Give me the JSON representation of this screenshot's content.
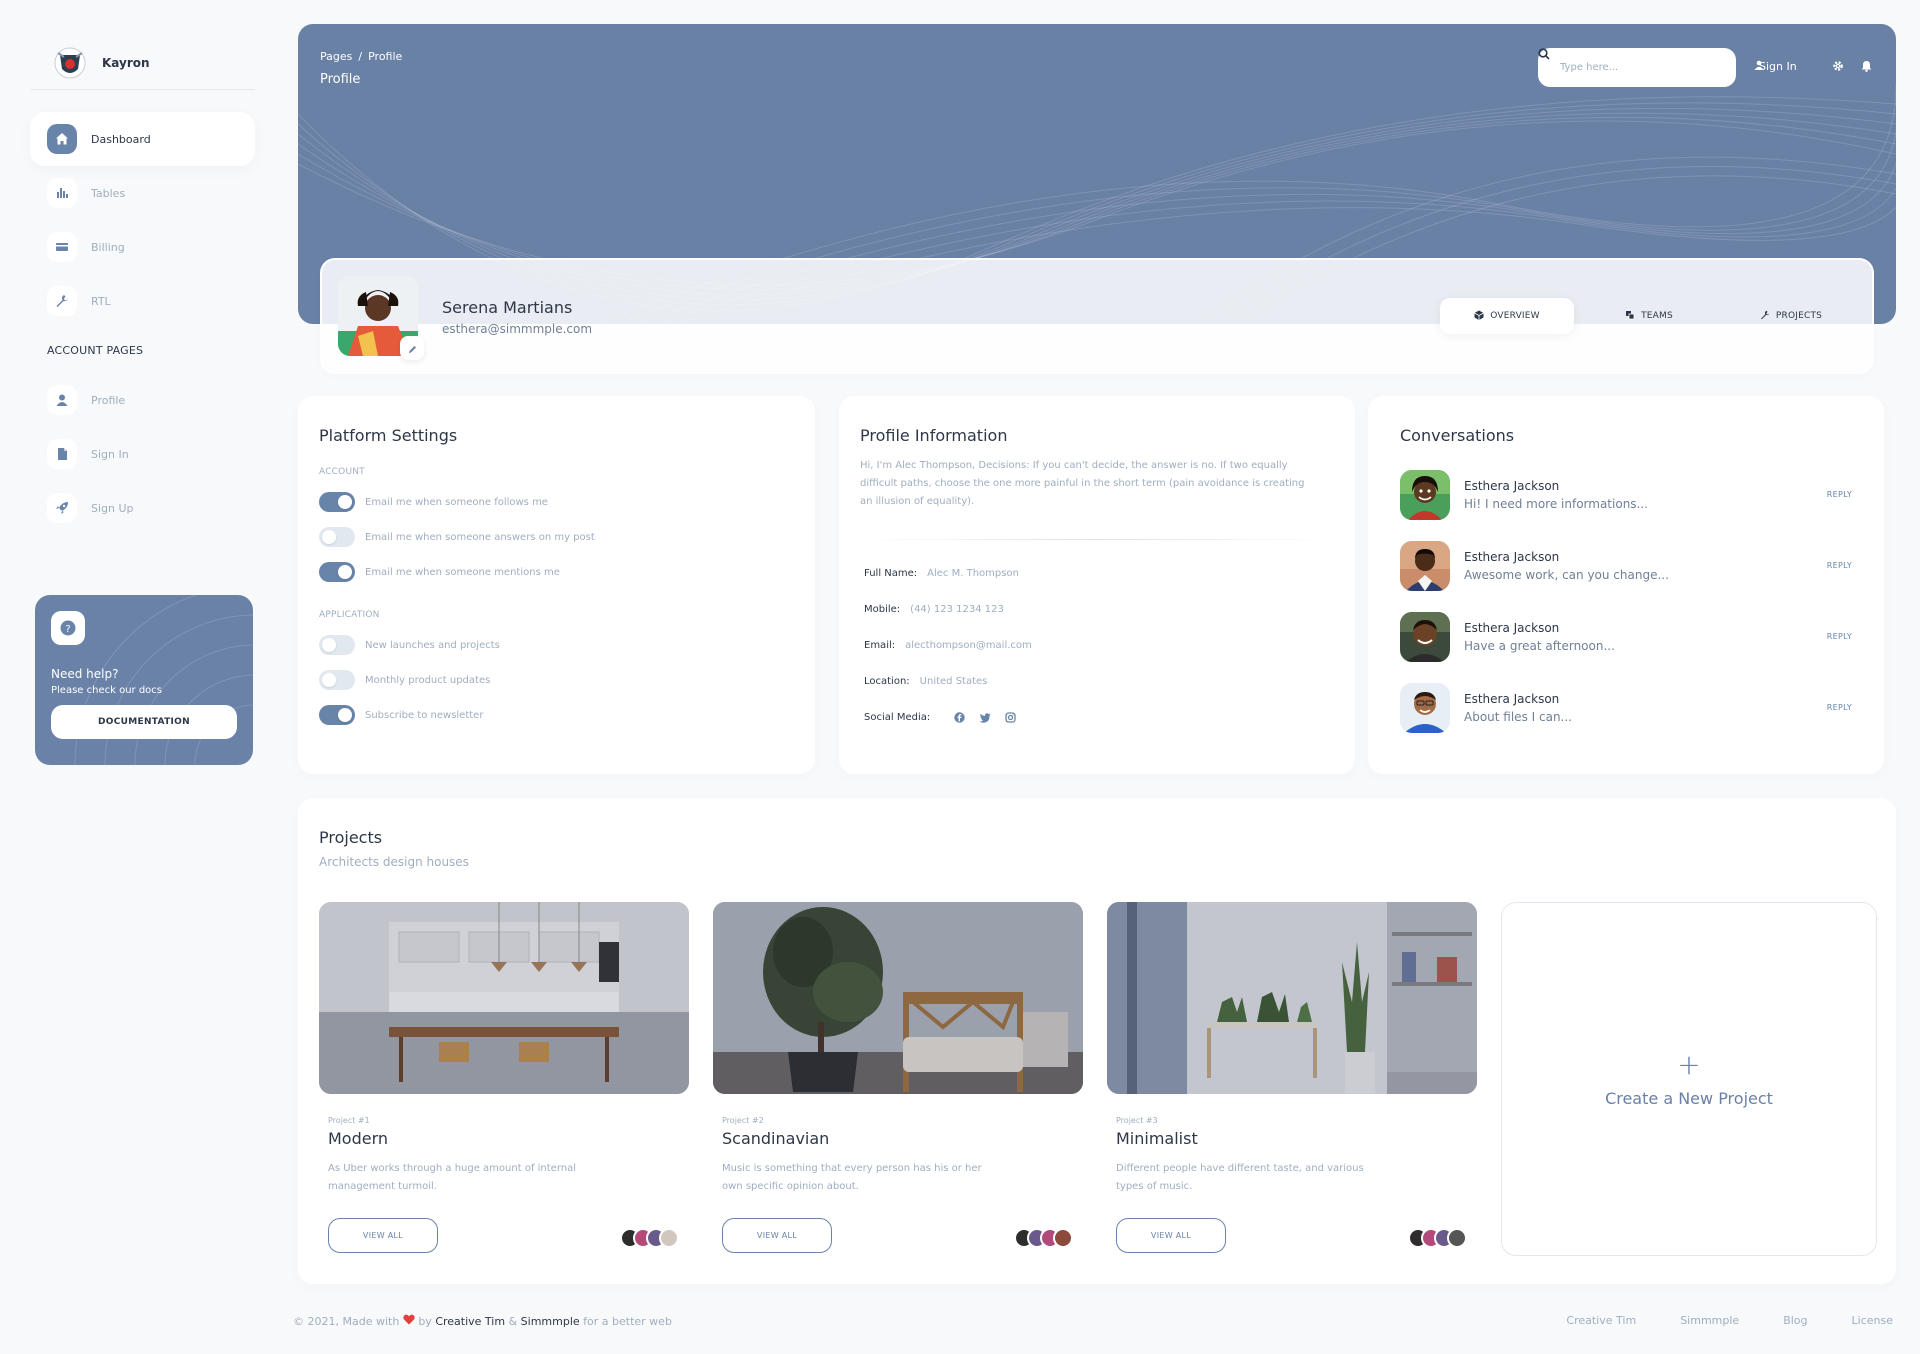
{
  "brand": {
    "name": "Kayron"
  },
  "sidebar": {
    "items": [
      {
        "label": "Dashboard",
        "icon": "home-icon",
        "active": true
      },
      {
        "label": "Tables",
        "icon": "bar-chart-icon"
      },
      {
        "label": "Billing",
        "icon": "credit-card-icon"
      },
      {
        "label": "RTL",
        "icon": "wrench-icon"
      }
    ],
    "account_title": "ACCOUNT PAGES",
    "account_items": [
      {
        "label": "Profile",
        "icon": "person-icon"
      },
      {
        "label": "Sign In",
        "icon": "document-icon"
      },
      {
        "label": "Sign Up",
        "icon": "rocket-icon"
      }
    ]
  },
  "help": {
    "title": "Need help?",
    "subtitle": "Please check our docs",
    "button": "DOCUMENTATION"
  },
  "header": {
    "breadcrumb_root": "Pages",
    "breadcrumb_sep": "/",
    "breadcrumb_current": "Profile",
    "title": "Profile",
    "search_placeholder": "Type here...",
    "sign_in": "Sign In"
  },
  "profile": {
    "name": "Serena Martians",
    "email": "esthera@simmmple.com",
    "tabs": [
      "OVERVIEW",
      "TEAMS",
      "PROJECTS"
    ]
  },
  "settings": {
    "title": "Platform Settings",
    "account_label": "ACCOUNT",
    "account": [
      {
        "label": "Email me when someone follows me",
        "on": true
      },
      {
        "label": "Email me when someone answers on my post",
        "on": false
      },
      {
        "label": "Email me when someone mentions me",
        "on": true
      }
    ],
    "application_label": "APPLICATION",
    "application": [
      {
        "label": "New launches and projects",
        "on": false
      },
      {
        "label": "Monthly product updates",
        "on": false
      },
      {
        "label": "Subscribe to newsletter",
        "on": true
      }
    ]
  },
  "info": {
    "title": "Profile Information",
    "bio": "Hi, I'm Alec Thompson, Decisions: If you can't decide, the answer is no. If two equally difficult paths, choose the one more painful in the short term (pain avoidance is creating an illusion of equality).",
    "fields": [
      {
        "key": "Full Name:",
        "value": "Alec M. Thompson"
      },
      {
        "key": "Mobile:",
        "value": "(44) 123 1234 123"
      },
      {
        "key": "Email:",
        "value": "alecthompson@mail.com"
      },
      {
        "key": "Location:",
        "value": "United States"
      }
    ],
    "social_label": "Social Media:"
  },
  "conversations": {
    "title": "Conversations",
    "reply": "REPLY",
    "items": [
      {
        "name": "Esthera Jackson",
        "message": "Hi! I need more informations..."
      },
      {
        "name": "Esthera Jackson",
        "message": "Awesome work, can you change..."
      },
      {
        "name": "Esthera Jackson",
        "message": "Have a great afternoon..."
      },
      {
        "name": "Esthera Jackson",
        "message": "About files I can..."
      }
    ]
  },
  "projects": {
    "title": "Projects",
    "subtitle": "Architects design houses",
    "view_all": "VIEW ALL",
    "items": [
      {
        "num": "Project #1",
        "name": "Modern",
        "desc": "As Uber works through a huge amount of internal management turmoil."
      },
      {
        "num": "Project #2",
        "name": "Scandinavian",
        "desc": "Music is something that every person has his or her own specific opinion about."
      },
      {
        "num": "Project #3",
        "name": "Minimalist",
        "desc": "Different people have different taste, and various types of music."
      }
    ],
    "create_label": "Create a New Project",
    "create_icon": "+"
  },
  "footer": {
    "prefix": "© 2021, Made with",
    "by": "by",
    "creative_tim": "Creative Tim",
    "amp": "&",
    "simmmple": "Simmmple",
    "suffix": "for a better web",
    "links": [
      "Creative Tim",
      "Simmmple",
      "Blog",
      "License"
    ]
  },
  "colors": {
    "accent": "#6984a9",
    "banner": "#6a81a6",
    "muted": "#a0aec0",
    "heart": "#e53e3e"
  }
}
